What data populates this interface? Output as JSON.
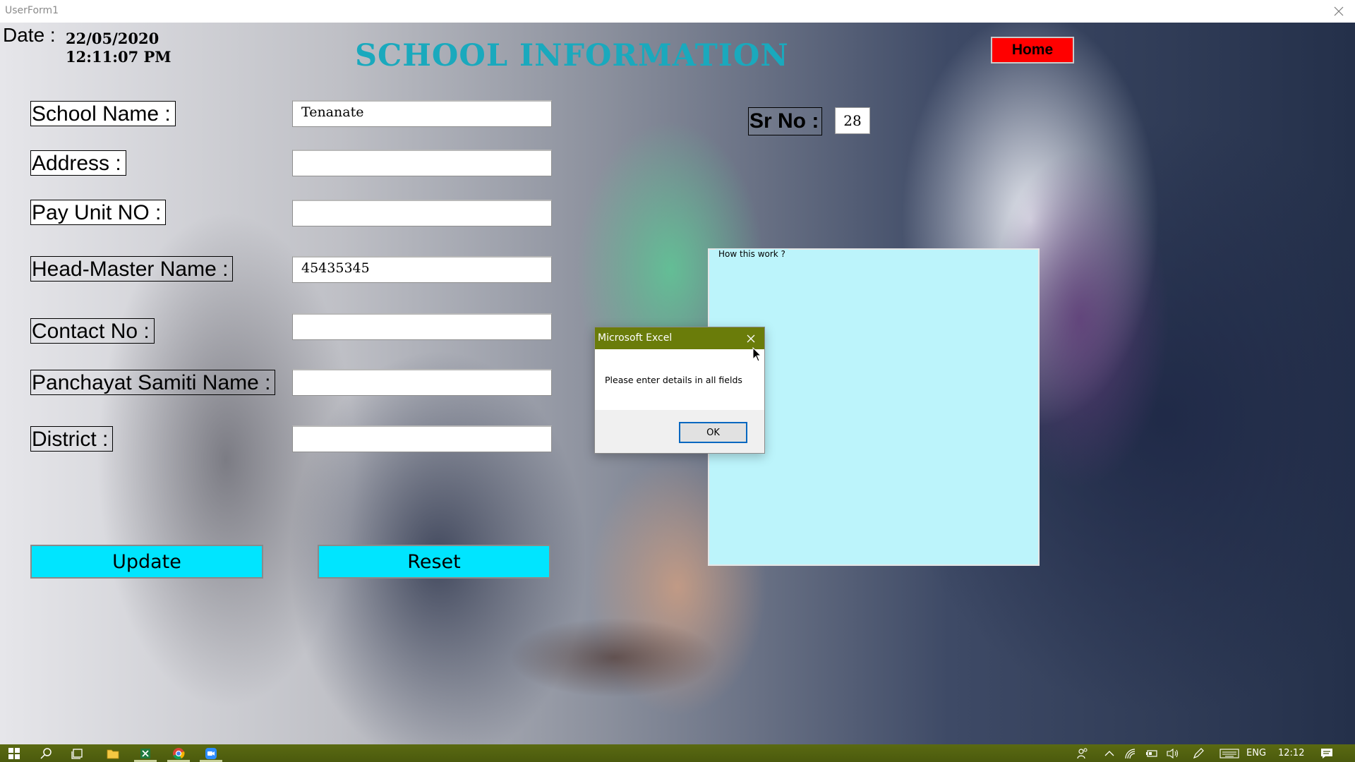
{
  "window": {
    "title": "UserForm1"
  },
  "header": {
    "date_label": "Date :",
    "date_value": "22/05/2020",
    "time_value": "12:11:07 PM",
    "title": "SCHOOL INFORMATION",
    "home_button": "Home"
  },
  "form": {
    "fields": [
      {
        "label": "School Name :",
        "value": "Tenanate"
      },
      {
        "label": "Address :",
        "value": ""
      },
      {
        "label": "Pay Unit NO :",
        "value": ""
      },
      {
        "label": "Head-Master Name :",
        "value": "45435345"
      },
      {
        "label": "Contact No :",
        "value": ""
      },
      {
        "label": "Panchayat Samiti Name :",
        "value": ""
      },
      {
        "label": "District :",
        "value": ""
      }
    ],
    "sr_no_label": "Sr No :",
    "sr_no_value": "28",
    "update_button": "Update",
    "reset_button": "Reset"
  },
  "frame": {
    "caption": "How this work ?"
  },
  "dialog": {
    "title": "Microsoft Excel",
    "message": "Please enter details in all fields",
    "ok_button": "OK"
  },
  "taskbar": {
    "icons": [
      "windows-start-icon",
      "search-icon",
      "task-view-icon",
      "file-explorer-icon",
      "excel-icon",
      "chrome-icon",
      "zoom-icon"
    ],
    "tray": {
      "language": "ENG",
      "time": "12:12"
    }
  },
  "colors": {
    "title_color": "#1aa9bd",
    "home_button_bg": "#ff0000",
    "action_button_bg": "#00e5ff",
    "frame_bg": "#bcf4fb",
    "dialog_titlebar": "#6a7c0a",
    "taskbar_bg": "#4b5a0d"
  }
}
